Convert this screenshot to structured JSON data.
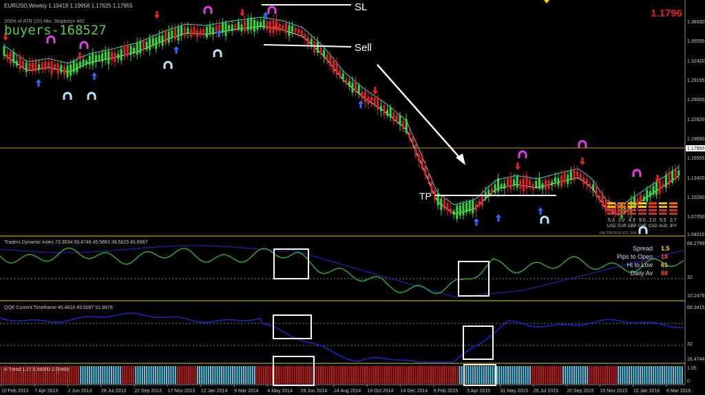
{
  "main_chart": {
    "symbol_header": "EURUSD,Weekly  1.19419 1.19958 1.17625 1.17955",
    "atr_note": "200% of ATR (20)   Min. Stoploss= 482",
    "watermark": "buyers-168527",
    "current_price": "1.1796",
    "price_tag": "1.17955",
    "price_axis": [
      "1.38930",
      "1.35555",
      "1.32420",
      "1.29195",
      "1.26055",
      "1.22920",
      "1.19690",
      "1.16555",
      "1.13420",
      "1.10280",
      "1.07050",
      "1.04015"
    ],
    "annotations": {
      "sl": "SL",
      "sell": "Sell",
      "tp": "TP"
    }
  },
  "currency_meter": {
    "values": [
      "5.3",
      "2.2",
      "4.3",
      "9.0",
      "2.0",
      "5.5",
      "2.7"
    ],
    "codes": [
      "USD",
      "EUR",
      "GBP",
      "CHF",
      "CAD",
      "AUD",
      "JPY"
    ],
    "footer": "XAX PROFILE        ECL XAX"
  },
  "tdi_panel": {
    "title": "Traders Dynamic Index 73.3634 59.4748 45.5863 38.5625 45.6987",
    "axis": [
      "68.2799",
      "32",
      "10.2479"
    ],
    "info": [
      {
        "label": "Spread",
        "value": "1.5",
        "color": "#ffd700"
      },
      {
        "label": "Pips to Open",
        "value": "18",
        "color": "#ff4040"
      },
      {
        "label": "Hi to Low",
        "value": "61",
        "color": "#ffd700"
      },
      {
        "label": "Daily Av",
        "value": "88",
        "color": "#ff4040"
      }
    ]
  },
  "qqe_panel": {
    "title": "QQE Current Timeframe 45.4816 49.5087 51.9976",
    "axis": [
      "66.3415",
      "32",
      "16.4744"
    ]
  },
  "trend_panel": {
    "title": "6-Trend 1.27 0.00000 2.00400",
    "axis": [
      "1.05",
      "0"
    ]
  },
  "time_axis": [
    "10 Feb 2013",
    "7 Apr 2013",
    "2 Jun 2013",
    "28 Jul 2013",
    "22 Sep 2013",
    "17 Nov 2013",
    "12 Jan 2014",
    "9 Mar 2014",
    "4 May 2014",
    "29 Jun 2014",
    "24 Aug 2014",
    "19 Oct 2014",
    "14 Dec 2014",
    "8 Feb 2015",
    "5 Apr 2015",
    "31 May 2015",
    "26 Jul 2015",
    "20 Sep 2015",
    "15 Nov 2015",
    "10 Jan 2016",
    "6 Mar 2016"
  ],
  "colors": {
    "bull": "#33dd33",
    "bear": "#dd2222",
    "separator": "#b8a400",
    "envelope_upper": "#3cb8c0",
    "envelope_lower": "#ffffff",
    "tdi_line": "#2ea82e",
    "qqe_line": "#2020cc",
    "trend_cyan": "#5fc9e8",
    "trend_red": "#c81c1c",
    "watermark": "#50d050"
  }
}
